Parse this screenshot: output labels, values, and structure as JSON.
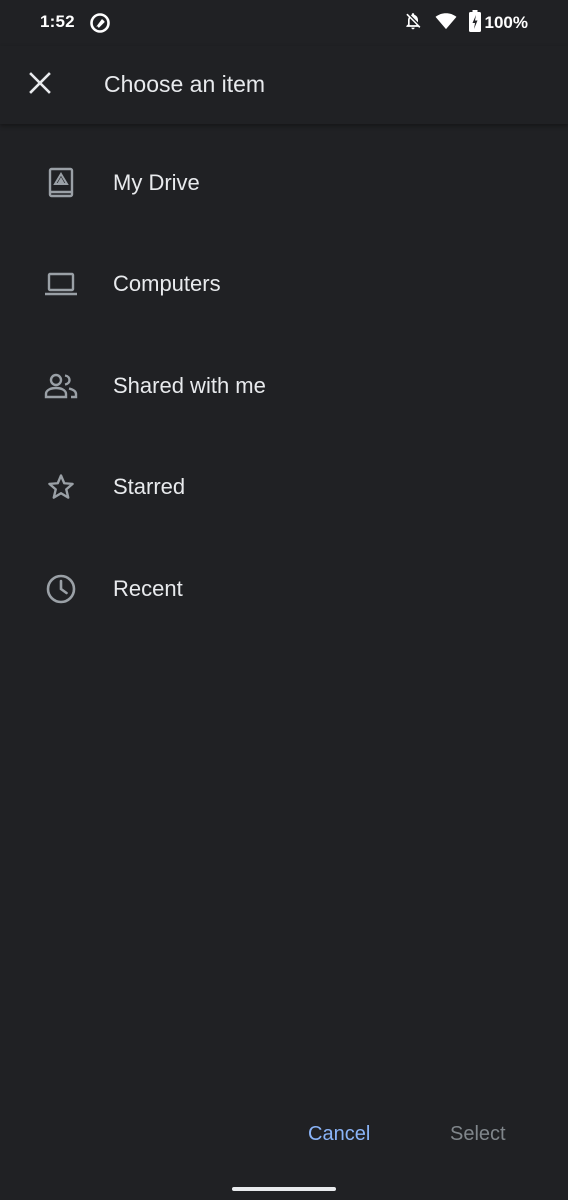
{
  "status_bar": {
    "time": "1:52",
    "battery": "100%",
    "icons": [
      "assistant-icon",
      "notifications-off-icon",
      "wifi-icon",
      "battery-charging-icon"
    ]
  },
  "header": {
    "title": "Choose an item",
    "close_icon": "close-icon"
  },
  "nav": {
    "items": [
      {
        "label": "My Drive",
        "icon": "drive-icon"
      },
      {
        "label": "Computers",
        "icon": "laptop-icon"
      },
      {
        "label": "Shared with me",
        "icon": "people-icon"
      },
      {
        "label": "Starred",
        "icon": "star-icon"
      },
      {
        "label": "Recent",
        "icon": "clock-icon"
      }
    ]
  },
  "footer": {
    "cancel_label": "Cancel",
    "select_label": "Select"
  },
  "colors": {
    "background": "#202124",
    "text": "#e8eaed",
    "icon": "#9aa0a6",
    "accent": "#8ab4f8",
    "disabled": "#80868b"
  }
}
